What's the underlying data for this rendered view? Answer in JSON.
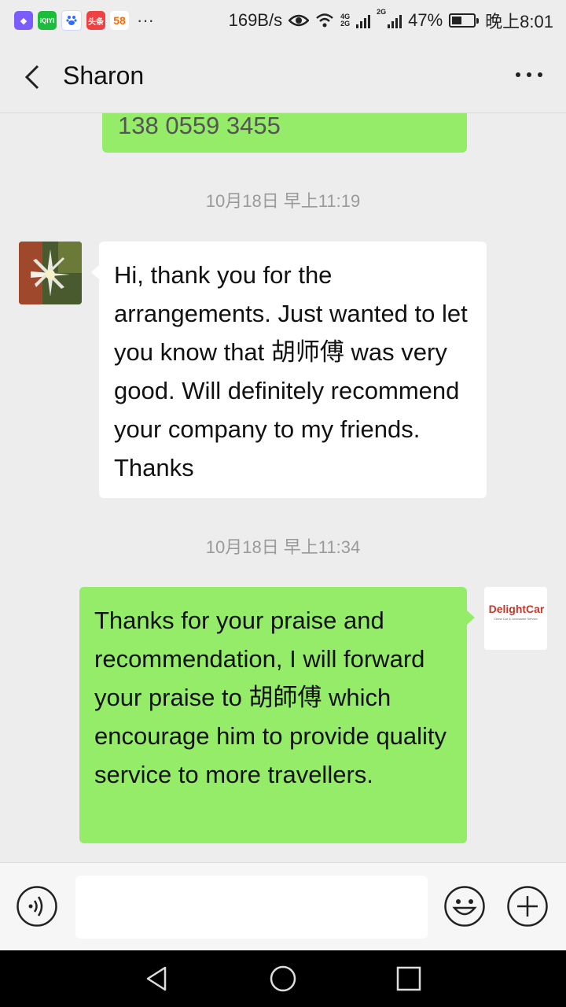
{
  "status_bar": {
    "apps": [
      {
        "icon": "app-purple-icon",
        "color": "#7b5cff",
        "label": ""
      },
      {
        "icon": "iqiyi-icon",
        "color": "#1bbd3a",
        "label": "iQIYI"
      },
      {
        "icon": "baidu-icon",
        "color": "#2f6bff",
        "label": ""
      },
      {
        "icon": "toutiao-icon",
        "color": "#f04142",
        "label": "头条"
      },
      {
        "icon": "58-icon",
        "color": "#ff6a00",
        "label": "58"
      }
    ],
    "overflow": "···",
    "network_speed": "169B/s",
    "net_4g": "4G",
    "net_2g": "2G",
    "battery": "47%",
    "battery_level": 0.47,
    "time": "晚上8:01"
  },
  "header": {
    "title": "Sharon"
  },
  "messages": [
    {
      "type": "out",
      "text": "138 0559 3455"
    },
    {
      "type": "time",
      "text": "10月18日 早上11:19"
    },
    {
      "type": "in",
      "text": "Hi, thank you for the arrangements. Just wanted to let you know that 胡师傅 was very good. Will definitely recommend your company to my friends. Thanks"
    },
    {
      "type": "time",
      "text": "10月18日 早上11:34"
    },
    {
      "type": "out",
      "text": "Thanks for your praise and recommendation, I will forward your praise to 胡師傅 which encourage him to provide quality service to more travellers."
    }
  ],
  "self_avatar": {
    "brand": "DelightCar",
    "tagline": "China Car & Limousine Service"
  },
  "colors": {
    "sent_bubble": "#95ec69",
    "received_bubble": "#ffffff",
    "background": "#ededed",
    "brand_red": "#c0392b"
  }
}
